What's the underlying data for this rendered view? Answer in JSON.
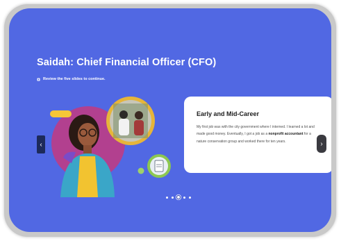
{
  "slide": {
    "title": "Saidah: Chief Financial Officer (CFO)",
    "hint": "Review the five slides to continue.",
    "section_heading": "Early and Mid-Career",
    "body_before": "My first job was with the city government where I interned. I learned a lot and made good money. Eventually, I got a job as a ",
    "body_bold": "nonprofit accountant",
    "body_after": " for a nature conservation group and worked there for ten years."
  },
  "navigation": {
    "prev_icon": "chevron-left-icon",
    "next_icon": "chevron-right-icon",
    "total_slides": 5,
    "current_slide": 3
  },
  "colors": {
    "card_bg": "#5168e3",
    "nav_prev_bg": "#1d2a5a",
    "nav_next_bg": "#3a3a40"
  }
}
